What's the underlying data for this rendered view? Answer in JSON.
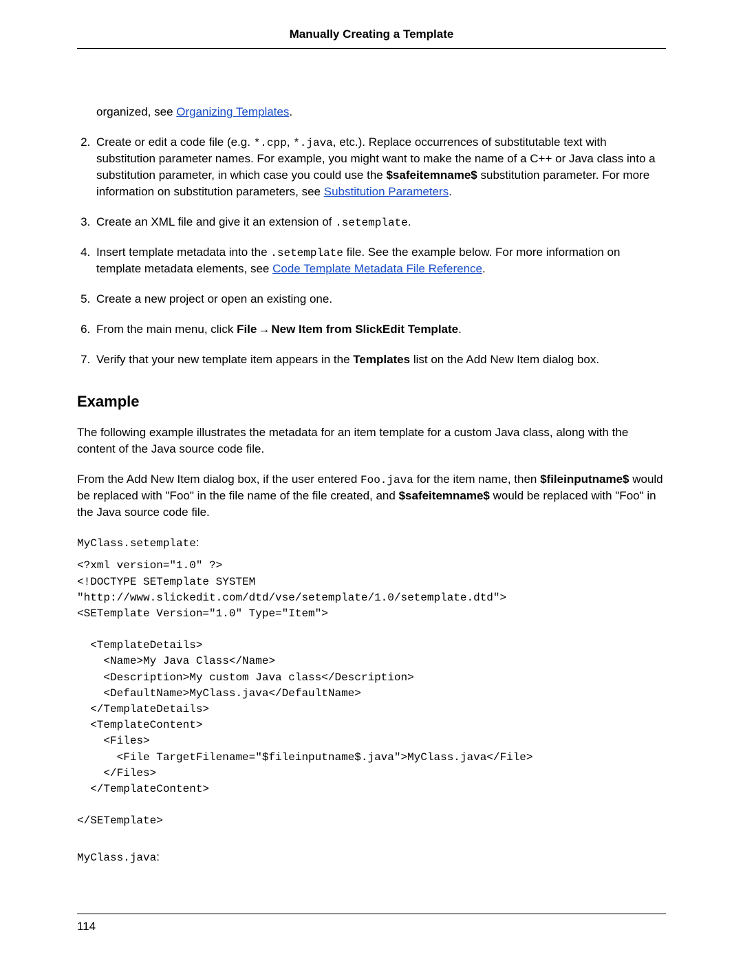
{
  "header": {
    "title": "Manually Creating a Template"
  },
  "intro": {
    "prefix": "organized, see ",
    "link": "Organizing Templates",
    "suffix": "."
  },
  "steps": {
    "s2": {
      "pre_code1": "Create or edit a code file (e.g. ",
      "code1": "*.cpp",
      "mid1": ", ",
      "code2": "*.java",
      "mid2": ", etc.). Replace occurrences of substitutable text with substitution parameter names. For example, you might want to make the name of a C++ or Java class into a substitution parameter, in which case you could use the ",
      "bold1": "$safeitemname$",
      "mid3": " substitution parameter. For more information on substitution parameters, see ",
      "link": "Substitution Parameters",
      "suffix": "."
    },
    "s3": {
      "pre": "Create an XML file and give it an extension of ",
      "code": ".setemplate",
      "suffix": "."
    },
    "s4": {
      "pre": "Insert template metadata into the ",
      "code": ".setemplate",
      "mid": " file. See the example below. For more information on template metadata elements, see ",
      "link": "Code Template Metadata File Reference",
      "suffix": "."
    },
    "s5": {
      "text": "Create a new project or open an existing one."
    },
    "s6": {
      "pre": "From the main menu, click ",
      "bold1": "File",
      "arrow": " → ",
      "bold2": "New Item from SlickEdit Template",
      "suffix": "."
    },
    "s7": {
      "pre": "Verify that your new template item appears in the ",
      "bold": "Templates",
      "suffix": " list on the Add New Item dialog box."
    }
  },
  "example": {
    "heading": "Example",
    "p1": "The following example illustrates the metadata for an item template for a custom Java class, along with the content of the Java source code file.",
    "p2": {
      "pre": "From the Add New Item dialog box, if the user entered ",
      "code": "Foo.java",
      "mid1": " for the item name, then ",
      "bold1": "$fileinputname$",
      "mid2": " would be replaced with \"Foo\" in the file name of the file created, and ",
      "bold2": "$safeitemname$",
      "mid3": " would be replaced with \"Foo\" in the Java source code file."
    },
    "file1_label": "MyClass.setemplate",
    "file1_colon": ":",
    "code1": "<?xml version=\"1.0\" ?>\n<!DOCTYPE SETemplate SYSTEM\n\"http://www.slickedit.com/dtd/vse/setemplate/1.0/setemplate.dtd\">\n<SETemplate Version=\"1.0\" Type=\"Item\">\n\n  <TemplateDetails>\n    <Name>My Java Class</Name>\n    <Description>My custom Java class</Description>\n    <DefaultName>MyClass.java</DefaultName>\n  </TemplateDetails>\n  <TemplateContent>\n    <Files>\n      <File TargetFilename=\"$fileinputname$.java\">MyClass.java</File>\n    </Files>\n  </TemplateContent>\n\n</SETemplate>",
    "file2_label": "MyClass.java",
    "file2_colon": ":"
  },
  "footer": {
    "page": "114"
  }
}
